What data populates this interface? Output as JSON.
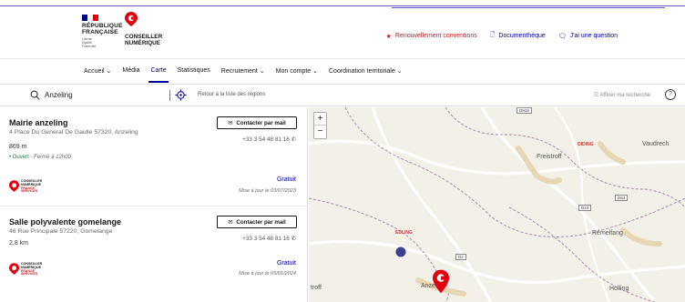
{
  "brand": {
    "republic_line1": "RÉPUBLIQUE",
    "republic_line2": "FRANÇAISE",
    "motto": [
      "Liberté",
      "Égalité",
      "Fraternité"
    ],
    "cn_line1": "CONSEILLER",
    "cn_line2": "NUMÉRIQUE",
    "colors": {
      "blue": "#000091",
      "red": "#e1000f",
      "accent_red": "#c9191e"
    }
  },
  "top_links": [
    {
      "label": "Renouvellement conventions",
      "icon": "star-icon"
    },
    {
      "label": "Documenthèque",
      "icon": "document-icon"
    },
    {
      "label": "J'ai une question",
      "icon": "chat-icon"
    }
  ],
  "nav": [
    {
      "label": "Accueil ⌄"
    },
    {
      "label": "Média"
    },
    {
      "label": "Carte",
      "active": true
    },
    {
      "label": "Statistiques"
    },
    {
      "label": "Recrutement ⌄"
    },
    {
      "label": "Mon compte ⌄"
    },
    {
      "label": "Coordination territoriale ⌄"
    }
  ],
  "search": {
    "value": "Anzeling",
    "back_label": "Retour à la liste des régions",
    "refine_label": "Affiner ma recherche",
    "help": "?"
  },
  "results": [
    {
      "title": "Mairie anzeling",
      "address": "4 Place Du General De Gaulle 57320, Anzeling",
      "distance": "869 m",
      "status": "• Ouvert",
      "hours": " - Fermé à 12h00",
      "contact_label": "Contacter par mail",
      "phone": "+33 3 54 48 81 16",
      "price": "Gratuit",
      "updated": "Mise à jour le 03/07/2023",
      "logo_text1": "CONSEILLER",
      "logo_text2": "NUMÉRIQUE",
      "logo_text3": "FRANCE",
      "logo_text4": "SERVICES"
    },
    {
      "title": "Salle polyvalente gomelange",
      "address": "46 Rue Principale 57220, Gomelange",
      "distance": "2,8 km",
      "contact_label": "Contacter par mail",
      "phone": "+33 3 54 48 81 16",
      "price": "Gratuit",
      "updated": "Mise à jour le 05/01/2024",
      "logo_text1": "CONSEILLER",
      "logo_text2": "NUMÉRIQUE",
      "logo_text3": "FRANCE",
      "logo_text4": "SERVICES"
    }
  ],
  "map": {
    "zoom_in": "+",
    "zoom_out": "−",
    "places": [
      "Freistroff",
      "Vaudrech",
      "Rémelfang",
      "Holling",
      "Anzel",
      "troff"
    ],
    "small_places": [
      "DIDING",
      "EDLING"
    ],
    "road_signs": [
      "D918",
      "D63",
      "D23",
      "D2"
    ]
  }
}
